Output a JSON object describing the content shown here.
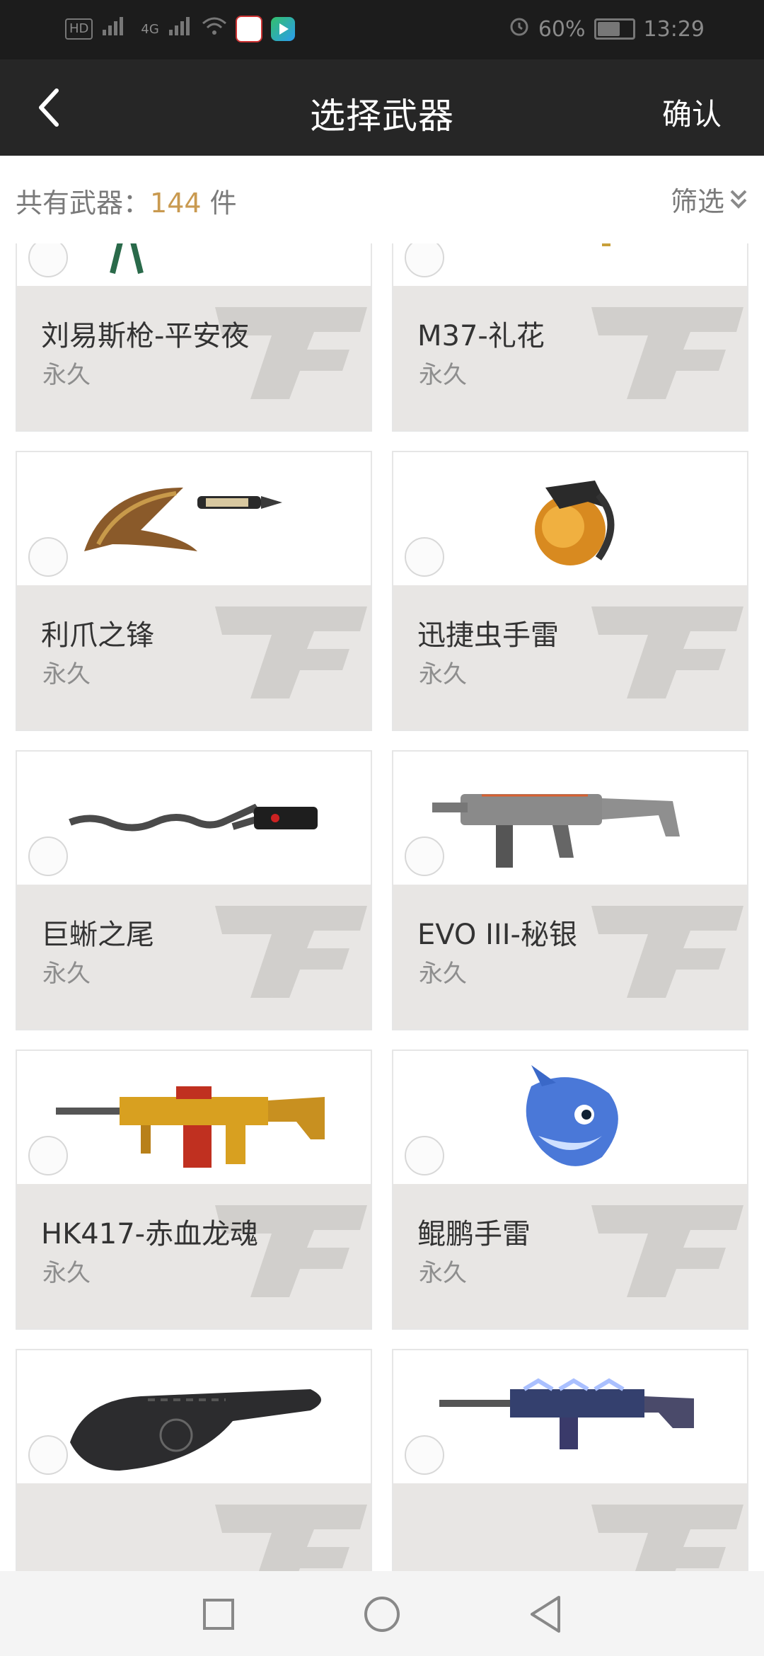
{
  "status_bar": {
    "hd_badge": "HD",
    "network_label": "4G",
    "battery": "60%",
    "time": "13:29"
  },
  "header": {
    "title": "选择武器",
    "confirm_label": "确认"
  },
  "summary": {
    "prefix": "共有武器：",
    "count": "144",
    "unit": " 件",
    "filter_label": "筛选"
  },
  "colors": {
    "header_bg": "#262626",
    "accent_count": "#c99a50",
    "card_info_bg": "#e8e6e4"
  },
  "weapons": [
    {
      "name": "刘易斯枪-平安夜",
      "term": "永久",
      "icon": "lewis-gun-christmas-icon"
    },
    {
      "name": "M37-礼花",
      "term": "永久",
      "icon": "shotgun-fireworks-icon"
    },
    {
      "name": "利爪之锋",
      "term": "永久",
      "icon": "claw-blade-icon"
    },
    {
      "name": "迅捷虫手雷",
      "term": "永久",
      "icon": "bug-grenade-icon"
    },
    {
      "name": "巨蜥之尾",
      "term": "永久",
      "icon": "serpent-blade-icon"
    },
    {
      "name": "EVO III-秘银",
      "term": "永久",
      "icon": "smg-mithril-icon"
    },
    {
      "name": "HK417-赤血龙魂",
      "term": "永久",
      "icon": "golden-rifle-icon"
    },
    {
      "name": "鲲鹏手雷",
      "term": "永久",
      "icon": "whale-grenade-icon"
    },
    {
      "name": "",
      "term": "",
      "icon": "tactical-knife-icon"
    },
    {
      "name": "",
      "term": "",
      "icon": "blue-rifle-icon"
    }
  ]
}
